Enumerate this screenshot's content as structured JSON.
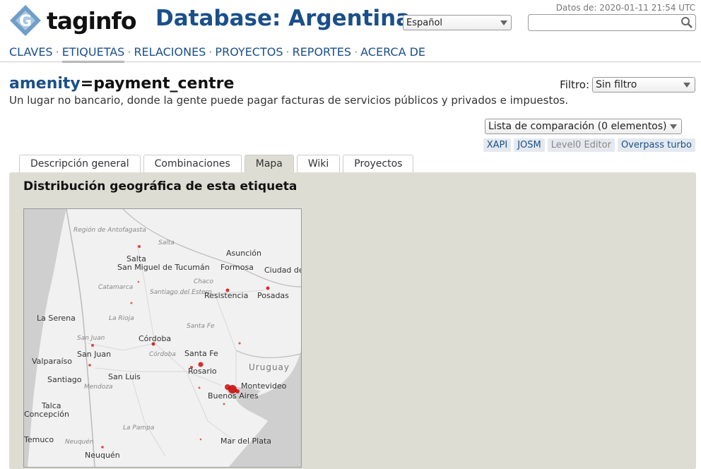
{
  "header": {
    "logo_text": "taginfo",
    "db_title": "Database: Argentina",
    "data_date": "Datos de: 2020-01-11 21:54 UTC",
    "language": "Español",
    "search_value": ""
  },
  "nav": {
    "items": [
      "CLAVES",
      "ETIQUETAS",
      "RELACIONES",
      "PROYECTOS",
      "REPORTES",
      "ACERCA DE"
    ],
    "active": "ETIQUETAS",
    "separator": "·"
  },
  "tag": {
    "key": "amenity",
    "eq": "=",
    "value": "payment_centre",
    "description": "Un lugar no bancario, donde la gente puede pagar facturas de servicios públicos y privados e impuestos."
  },
  "filter": {
    "label": "Filtro:",
    "value": "Sin filtro"
  },
  "compare": {
    "value": "Lista de comparación (0 elementos)"
  },
  "tools": [
    "XAPI",
    "JOSM",
    "Level0 Editor",
    "Overpass turbo"
  ],
  "tabs": [
    "Descripción general",
    "Combinaciones",
    "Mapa",
    "Wiki",
    "Proyectos"
  ],
  "active_tab": "Mapa",
  "panel": {
    "heading": "Distribución geográfica de esta etiqueta"
  },
  "map": {
    "region_labels": [
      "Región de Antofagasta",
      "Salta",
      "Catamarca",
      "Santiago del Estero",
      "Chaco",
      "La Rioja",
      "Santa Fe",
      "San Juan",
      "Córdoba",
      "Mendoza",
      "La Pampa",
      "Neuquén"
    ],
    "country_labels": [
      "Uruguay"
    ],
    "city_labels": [
      "Salta",
      "San Miguel de Tucumán",
      "Asunción",
      "Formosa",
      "Ciudad del Este",
      "Resistencia",
      "Posadas",
      "La Serena",
      "Córdoba",
      "San Juan",
      "Santa Fe",
      "Valparaíso",
      "Santiago",
      "San Luis",
      "Rosario",
      "Montevideo",
      "Buenos Aires",
      "Talca",
      "Concepción",
      "Temuco",
      "Mar del Plata",
      "Neuquén"
    ]
  },
  "colors": {
    "brand_blue": "#1a4f8a",
    "panel_bg": "#ddddd3",
    "heat_red": "#cc0000"
  }
}
